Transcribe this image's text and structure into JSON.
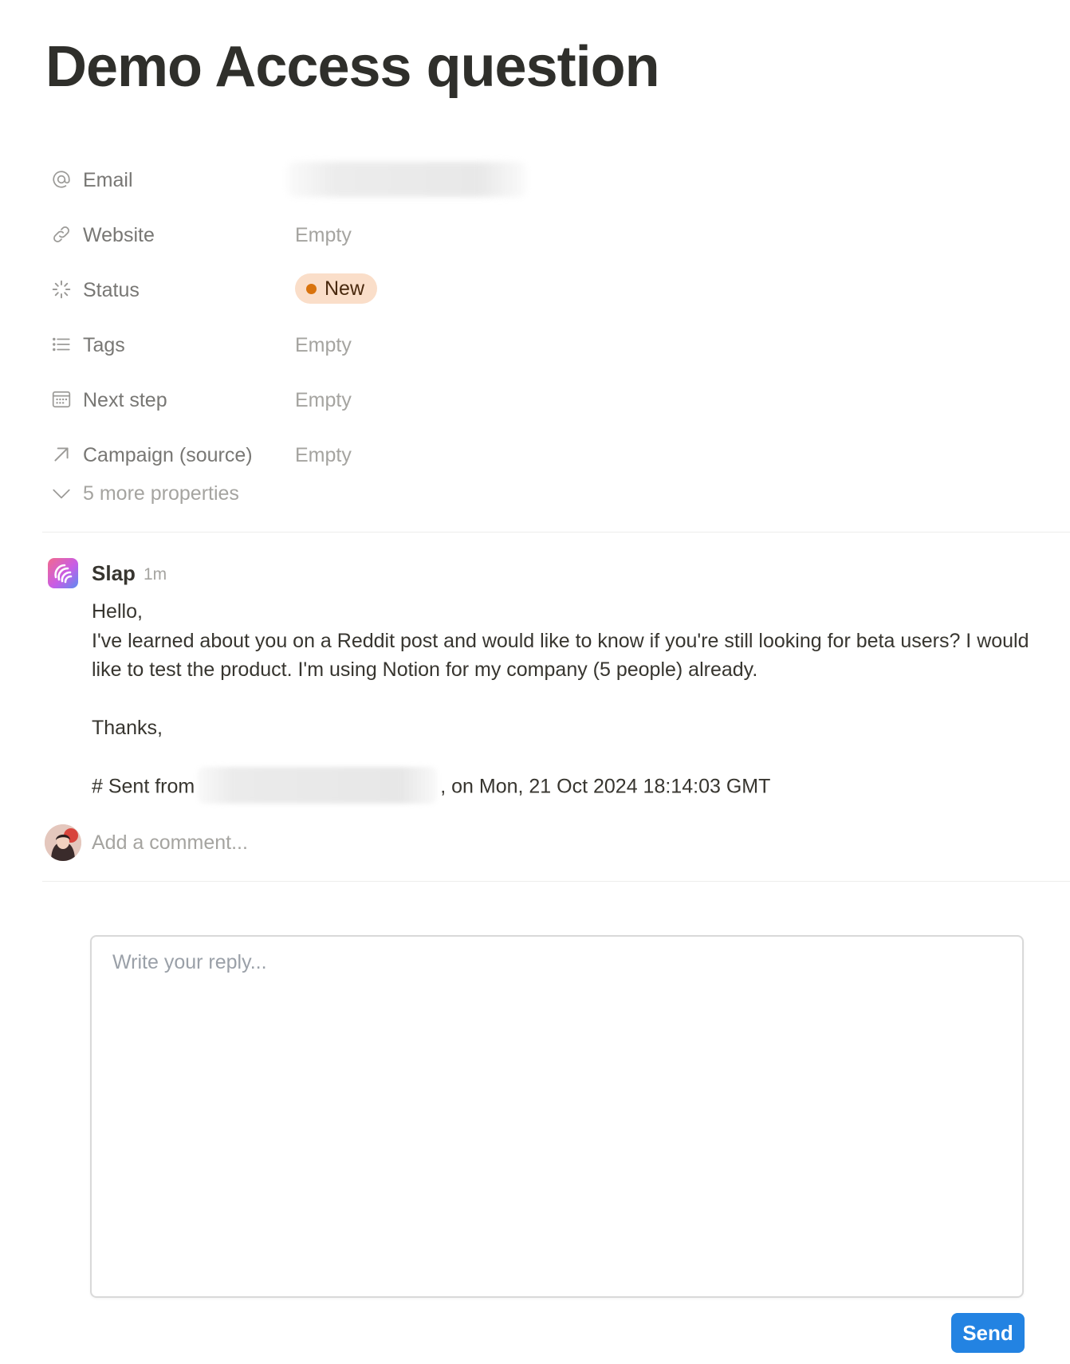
{
  "page": {
    "title": "Demo Access question"
  },
  "properties": [
    {
      "icon": "at-icon",
      "name": "Email",
      "value": "",
      "redacted": true
    },
    {
      "icon": "link-icon",
      "name": "Website",
      "value": "Empty"
    },
    {
      "icon": "status-loader-icon",
      "name": "Status",
      "value": "New",
      "pill": true
    },
    {
      "icon": "list-icon",
      "name": "Tags",
      "value": "Empty"
    },
    {
      "icon": "calendar-icon",
      "name": "Next step",
      "value": "Empty"
    },
    {
      "icon": "arrow-up-right-icon",
      "name": "Campaign (source)",
      "value": "Empty"
    }
  ],
  "status": {
    "label": "New",
    "dot_color": "#d9730d",
    "pill_bg": "#fadec9"
  },
  "more_properties": {
    "label": "5 more properties"
  },
  "comment": {
    "author": "Slap",
    "time": "1m",
    "lines": {
      "greeting": "Hello,",
      "body": "I've learned about you on a Reddit post and would like to know if you're still looking for beta users? I would like to test the product. I'm using Notion for my company (5 people) already.",
      "signoff": "Thanks,",
      "sent_prefix": "# Sent from",
      "sent_suffix": ", on Mon, 21 Oct 2024 18:14:03 GMT"
    }
  },
  "add_comment": {
    "placeholder": "Add a comment..."
  },
  "reply": {
    "placeholder": "Write your reply...",
    "send_label": "Send",
    "accent": "#2383e2"
  }
}
